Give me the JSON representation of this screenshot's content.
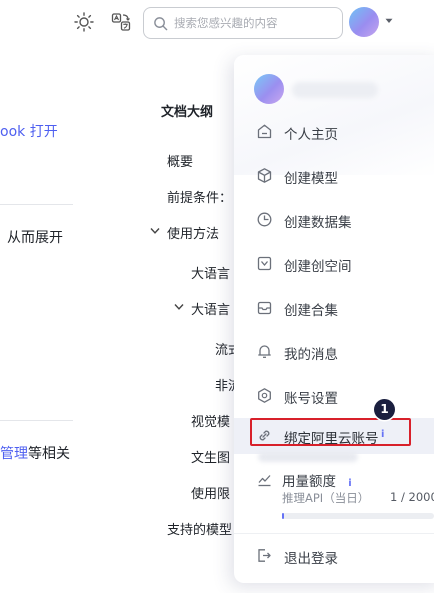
{
  "topbar": {
    "search_placeholder": "搜索您感兴趣的内容"
  },
  "left_article": {
    "line1_link": "ook 打开",
    "line2": "从而展开",
    "line3_link": "管理",
    "line3_rest": "等相关"
  },
  "outline": {
    "title": "文档大纲",
    "items": [
      {
        "label": "概要"
      },
      {
        "label": "前提条件："
      },
      {
        "label": "使用方法"
      },
      {
        "label": "大语言"
      },
      {
        "label": "大语言"
      },
      {
        "label": "流式"
      },
      {
        "label": "非流"
      },
      {
        "label": "视觉模"
      },
      {
        "label": "文生图"
      },
      {
        "label": "使用限"
      },
      {
        "label": "支持的模型"
      }
    ]
  },
  "menu": {
    "items": [
      {
        "label": "个人主页",
        "icon": "home-icon"
      },
      {
        "label": "创建模型",
        "icon": "cube-icon"
      },
      {
        "label": "创建数据集",
        "icon": "pie-chart-icon"
      },
      {
        "label": "创建创空间",
        "icon": "space-icon"
      },
      {
        "label": "创建合集",
        "icon": "collection-icon"
      },
      {
        "label": "我的消息",
        "icon": "bell-icon"
      },
      {
        "label": "账号设置",
        "icon": "settings-icon"
      },
      {
        "label": "绑定阿里云账号",
        "icon": "link-icon"
      }
    ],
    "info_mark": "i",
    "usage": {
      "label": "用量额度",
      "info_mark": "i",
      "sub_label": "推理API（当日）",
      "count": "1 / 2000",
      "fraction": 0.0005
    },
    "logout_label": "退出登录"
  },
  "annotation": {
    "step_number": "1"
  },
  "colors": {
    "accent": "#6673f5",
    "highlight": "#d8202a",
    "badge": "#1a1f3f"
  }
}
